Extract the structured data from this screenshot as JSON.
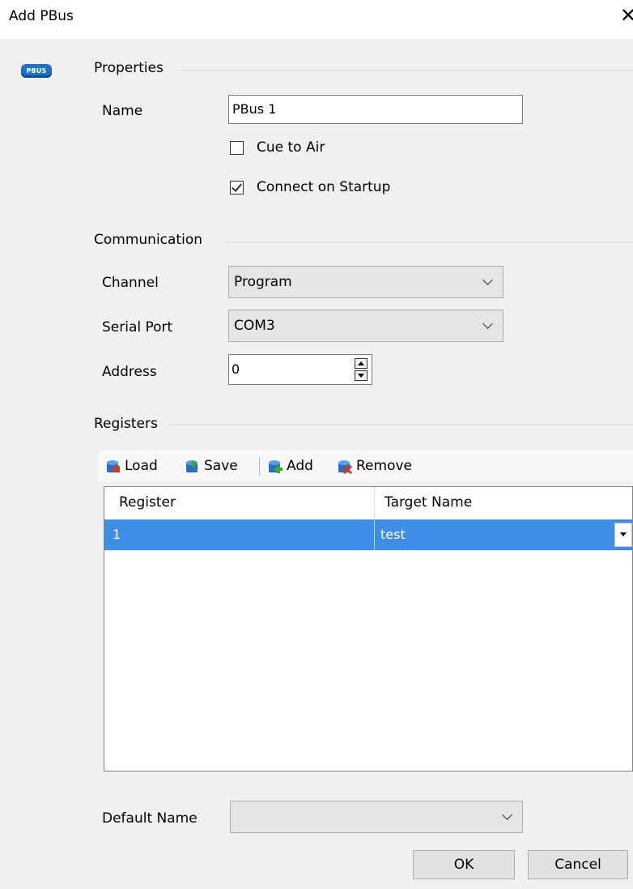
{
  "window": {
    "title": "Add PBus",
    "close_glyph": "✕"
  },
  "logo": {
    "text": "PBUS",
    "icon": "pbus-logo-icon",
    "color": "#1e73c8"
  },
  "properties": {
    "section_label": "Properties",
    "name_label": "Name",
    "name_value": "PBus 1",
    "cue_to_air": {
      "label": "Cue to Air",
      "checked": false
    },
    "connect_on_startup": {
      "label": "Connect on Startup",
      "checked": true
    }
  },
  "communication": {
    "section_label": "Communication",
    "channel_label": "Channel",
    "channel_value": "Program",
    "serial_port_label": "Serial Port",
    "serial_port_value": "COM3",
    "address_label": "Address",
    "address_value": "0"
  },
  "registers": {
    "section_label": "Registers",
    "toolbar": {
      "load_label": "Load",
      "save_label": "Save",
      "add_label": "Add",
      "remove_label": "Remove"
    },
    "columns": [
      "Register",
      "Target Name"
    ],
    "rows": [
      {
        "register": "1",
        "target_name": "test",
        "selected": true
      }
    ],
    "selection_color": "#3f8ee6"
  },
  "default_name": {
    "label": "Default Name",
    "value": ""
  },
  "buttons": {
    "ok_label": "OK",
    "cancel_label": "Cancel"
  }
}
